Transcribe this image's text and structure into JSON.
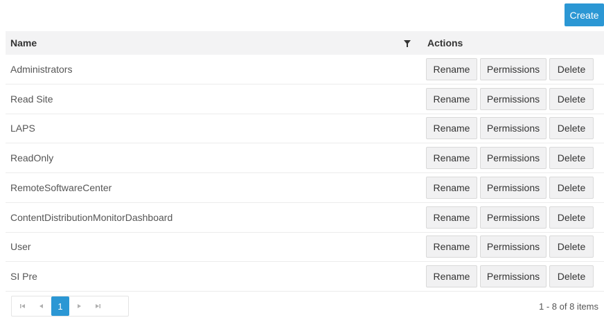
{
  "toolbar": {
    "create_label": "Create"
  },
  "grid": {
    "columns": {
      "name": "Name",
      "actions": "Actions"
    },
    "rows": [
      {
        "name": "Administrators"
      },
      {
        "name": "Read Site"
      },
      {
        "name": "LAPS"
      },
      {
        "name": "ReadOnly"
      },
      {
        "name": "RemoteSoftwareCenter"
      },
      {
        "name": "ContentDistributionMonitorDashboard"
      },
      {
        "name": "User"
      },
      {
        "name": "SI Pre"
      }
    ],
    "action_labels": {
      "rename": "Rename",
      "permissions": "Permissions",
      "delete": "Delete"
    }
  },
  "pager": {
    "first_icon": "first-page-icon",
    "prev_icon": "prev-page-icon",
    "current_page": "1",
    "next_icon": "next-page-icon",
    "last_icon": "last-page-icon",
    "info": "1 - 8 of 8 items"
  },
  "colors": {
    "accent": "#2b97d4",
    "header_bg": "#f3f3f4",
    "button_bg": "#f1f1f2"
  }
}
